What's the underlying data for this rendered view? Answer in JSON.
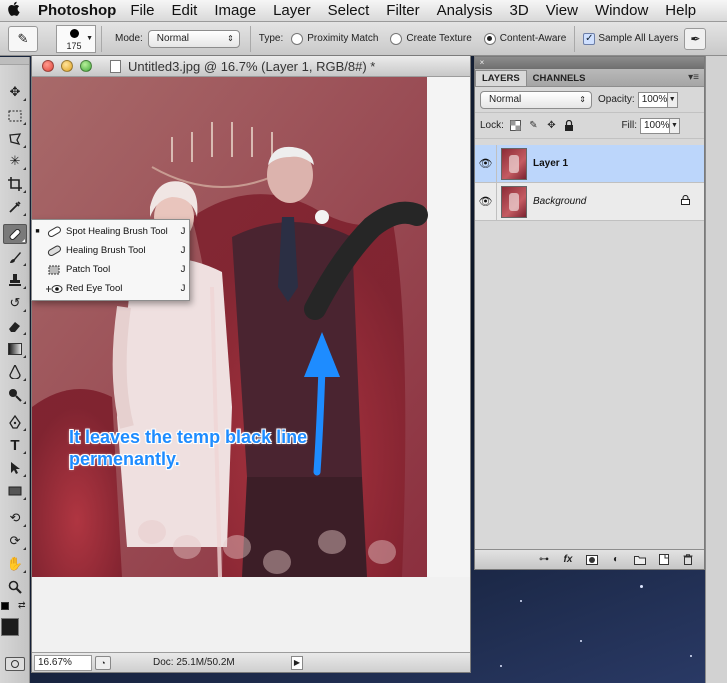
{
  "menubar": {
    "apple": "",
    "app_name": "Photoshop",
    "menus": [
      "File",
      "Edit",
      "Image",
      "Layer",
      "Select",
      "Filter",
      "Analysis",
      "3D",
      "View",
      "Window",
      "Help"
    ]
  },
  "options": {
    "brush_size": "175",
    "mode_label": "Mode:",
    "mode_value": "Normal",
    "type_label": "Type:",
    "radio_proximity": "Proximity Match",
    "radio_texture": "Create Texture",
    "radio_content": "Content-Aware",
    "selected_type": "Content-Aware",
    "sample_all_label": "Sample All Layers",
    "sample_all_checked": true
  },
  "document": {
    "title": "Untitled3.jpg @ 16.7% (Layer 1, RGB/8#) *",
    "zoom": "16.67%",
    "doc_size": "Doc: 25.1M/50.2M"
  },
  "flyout": {
    "items": [
      {
        "label": "Spot Healing Brush Tool",
        "shortcut": "J",
        "active": true,
        "icon": "spot-healing-icon"
      },
      {
        "label": "Healing Brush Tool",
        "shortcut": "J",
        "active": false,
        "icon": "bandage-icon"
      },
      {
        "label": "Patch Tool",
        "shortcut": "J",
        "active": false,
        "icon": "patch-icon"
      },
      {
        "label": "Red Eye Tool",
        "shortcut": "J",
        "active": false,
        "icon": "red-eye-icon"
      }
    ]
  },
  "annotation": {
    "line1": "It leaves the temp black line",
    "line2": "permenantly.",
    "color": "#1e8cff"
  },
  "layers_panel": {
    "tab_layers": "LAYERS",
    "tab_channels": "CHANNELS",
    "blend_mode": "Normal",
    "opacity_label": "Opacity:",
    "opacity": "100%",
    "lock_label": "Lock:",
    "fill_label": "Fill:",
    "fill": "100%",
    "layers": [
      {
        "name": "Layer 1",
        "selected": true,
        "locked": false
      },
      {
        "name": "Background",
        "selected": false,
        "locked": true
      }
    ],
    "selected_color": "#bcd6fb"
  }
}
